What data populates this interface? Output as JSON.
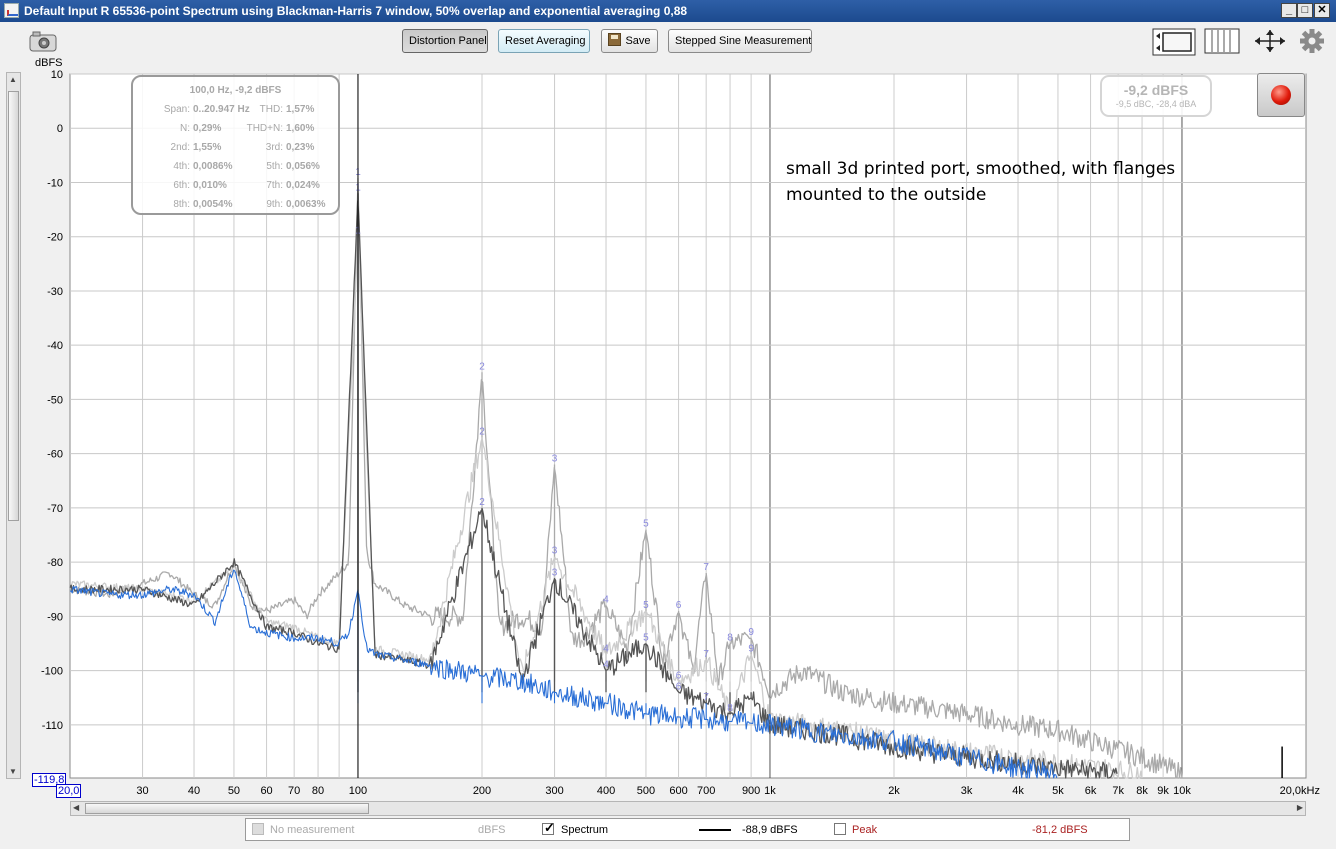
{
  "window": {
    "title": "Default Input R 65536-point Spectrum using Blackman-Harris 7 window, 50% overlap and exponential averaging 0,88",
    "minimize": "_",
    "maximize": "□",
    "close": "✕"
  },
  "toolbar": {
    "distortion_panel": "Distortion Panel",
    "reset_averaging": "Reset Averaging",
    "save": "Save",
    "stepped_sine": "Stepped Sine Measurement",
    "icons": [
      "camera-icon",
      "view-full-icon",
      "view-bars-icon",
      "zoom-arrows-icon",
      "gear-icon"
    ]
  },
  "info_box": {
    "heading": "100,0 Hz, -9,2 dBFS",
    "rows": [
      [
        {
          "k": "Span:",
          "v": "0..20.947 Hz"
        },
        {
          "k": "THD:",
          "v": "1,57%"
        }
      ],
      [
        {
          "k": "N:",
          "v": "0,29%"
        },
        {
          "k": "THD+N:",
          "v": "1,60%"
        }
      ],
      [
        {
          "k": "2nd:",
          "v": "1,55%"
        },
        {
          "k": "3rd:",
          "v": "0,23%"
        }
      ],
      [
        {
          "k": "4th:",
          "v": "0,0086%"
        },
        {
          "k": "5th:",
          "v": "0,056%"
        }
      ],
      [
        {
          "k": "6th:",
          "v": "0,010%"
        },
        {
          "k": "7th:",
          "v": "0,024%"
        }
      ],
      [
        {
          "k": "8th:",
          "v": "0,0054%"
        },
        {
          "k": "9th:",
          "v": "0,0063%"
        }
      ]
    ]
  },
  "level_box": {
    "main": "-9,2 dBFS",
    "sub": "-9,5 dBC, -28,4 dBA"
  },
  "annotation": [
    "small 3d printed port, smoothed, with flanges",
    "mounted to the outside"
  ],
  "y_min_box": "-119,8",
  "x_min_box": "20,0",
  "legend": {
    "items": [
      {
        "label": "No measurement",
        "unit": "dBFS",
        "checked": false,
        "disabled": true
      },
      {
        "label": "Spectrum",
        "value": "-88,9 dBFS",
        "checked": true
      },
      {
        "label": "Peak",
        "value": "-81,2 dBFS",
        "checked": false
      }
    ]
  },
  "colors": {
    "spectrum": "#000000",
    "blue_trace": "#2a6fd6",
    "peak": "#aa2222",
    "grid": "#c8c8c8",
    "harmonic_label": "#8888dd"
  },
  "chart_data": {
    "type": "line",
    "ylabel": "dBFS",
    "xlabel": "",
    "x_scale": "log",
    "xlim": [
      20,
      20000
    ],
    "ylim": [
      -119.8,
      10
    ],
    "grid": true,
    "y_ticks": [
      10,
      0,
      -10,
      -20,
      -30,
      -40,
      -50,
      -60,
      -70,
      -80,
      -90,
      -100,
      -110
    ],
    "x_ticks": [
      {
        "v": 30,
        "l": "30"
      },
      {
        "v": 40,
        "l": "40"
      },
      {
        "v": 50,
        "l": "50"
      },
      {
        "v": 60,
        "l": "60"
      },
      {
        "v": 70,
        "l": "70"
      },
      {
        "v": 80,
        "l": "80"
      },
      {
        "v": 100,
        "l": "100"
      },
      {
        "v": 200,
        "l": "200"
      },
      {
        "v": 300,
        "l": "300"
      },
      {
        "v": 400,
        "l": "400"
      },
      {
        "v": 500,
        "l": "500"
      },
      {
        "v": 600,
        "l": "600"
      },
      {
        "v": 700,
        "l": "700"
      },
      {
        "v": 900,
        "l": "900"
      },
      {
        "v": 1000,
        "l": "1k"
      },
      {
        "v": 2000,
        "l": "2k"
      },
      {
        "v": 3000,
        "l": "3k"
      },
      {
        "v": 4000,
        "l": "4k"
      },
      {
        "v": 5000,
        "l": "5k"
      },
      {
        "v": 6000,
        "l": "6k"
      },
      {
        "v": 7000,
        "l": "7k"
      },
      {
        "v": 8000,
        "l": "8k"
      },
      {
        "v": 9000,
        "l": "9k"
      },
      {
        "v": 10000,
        "l": "10k"
      },
      {
        "v": 20000,
        "l": "20,0kHz"
      }
    ],
    "harmonics": [
      {
        "label": "1",
        "x": 100,
        "ys": [
          -9.2,
          -12,
          -20
        ]
      },
      {
        "label": "2",
        "x": 200,
        "ys": [
          -45,
          -57,
          -70
        ]
      },
      {
        "label": "3",
        "x": 300,
        "ys": [
          -62,
          -79,
          -83
        ]
      },
      {
        "label": "4",
        "x": 400,
        "ys": [
          -88,
          -97,
          -100
        ]
      },
      {
        "label": "5",
        "x": 500,
        "ys": [
          -74,
          -89,
          -95
        ]
      },
      {
        "label": "6",
        "x": 600,
        "ys": [
          -89,
          -102,
          -104
        ]
      },
      {
        "label": "7",
        "x": 700,
        "ys": [
          -82,
          -98,
          -106
        ]
      },
      {
        "label": "8",
        "x": 800,
        "ys": [
          -95,
          -108
        ]
      },
      {
        "label": "9",
        "x": 900,
        "ys": [
          -94,
          -97
        ]
      }
    ],
    "series": [
      {
        "name": "",
        "color": "#aaaaaa",
        "points": [
          [
            20,
            -85
          ],
          [
            25,
            -86
          ],
          [
            30,
            -84
          ],
          [
            35,
            -82
          ],
          [
            40,
            -86
          ],
          [
            45,
            -88
          ],
          [
            50,
            -80
          ],
          [
            55,
            -88
          ],
          [
            60,
            -89
          ],
          [
            65,
            -88
          ],
          [
            70,
            -87
          ],
          [
            75,
            -90
          ],
          [
            80,
            -86
          ],
          [
            85,
            -84
          ],
          [
            90,
            -82
          ],
          [
            95,
            -80
          ],
          [
            100,
            -9.2
          ],
          [
            105,
            -78
          ],
          [
            110,
            -84
          ],
          [
            120,
            -86
          ],
          [
            130,
            -88
          ],
          [
            150,
            -90
          ],
          [
            180,
            -90
          ],
          [
            200,
            -45
          ],
          [
            220,
            -92
          ],
          [
            250,
            -90
          ],
          [
            280,
            -92
          ],
          [
            300,
            -62
          ],
          [
            330,
            -94
          ],
          [
            350,
            -94
          ],
          [
            400,
            -88
          ],
          [
            450,
            -96
          ],
          [
            500,
            -74
          ],
          [
            550,
            -98
          ],
          [
            600,
            -89
          ],
          [
            650,
            -100
          ],
          [
            700,
            -82
          ],
          [
            750,
            -102
          ],
          [
            800,
            -95
          ],
          [
            900,
            -94
          ],
          [
            1000,
            -104
          ],
          [
            1200,
            -100
          ],
          [
            1500,
            -104
          ],
          [
            2000,
            -106
          ],
          [
            2500,
            -107
          ],
          [
            3000,
            -108
          ],
          [
            4000,
            -110
          ],
          [
            5000,
            -111
          ],
          [
            6000,
            -113
          ],
          [
            8000,
            -116
          ],
          [
            10000,
            -119
          ]
        ]
      },
      {
        "name": "",
        "color": "#cccccc",
        "points": [
          [
            20,
            -84
          ],
          [
            30,
            -85
          ],
          [
            40,
            -87
          ],
          [
            50,
            -81
          ],
          [
            60,
            -91
          ],
          [
            70,
            -92
          ],
          [
            80,
            -94
          ],
          [
            90,
            -95
          ],
          [
            100,
            -20
          ],
          [
            110,
            -96
          ],
          [
            150,
            -98
          ],
          [
            200,
            -57
          ],
          [
            250,
            -101
          ],
          [
            300,
            -79
          ],
          [
            400,
            -97
          ],
          [
            500,
            -89
          ],
          [
            600,
            -102
          ],
          [
            700,
            -98
          ],
          [
            800,
            -108
          ],
          [
            900,
            -97
          ],
          [
            1000,
            -109
          ],
          [
            1500,
            -111
          ],
          [
            2000,
            -113
          ],
          [
            3000,
            -115
          ],
          [
            5000,
            -117
          ],
          [
            8000,
            -119
          ]
        ]
      },
      {
        "name": "",
        "color": "#555555",
        "points": [
          [
            20,
            -85
          ],
          [
            30,
            -85
          ],
          [
            40,
            -88
          ],
          [
            50,
            -80
          ],
          [
            60,
            -92
          ],
          [
            70,
            -93
          ],
          [
            80,
            -95
          ],
          [
            90,
            -96
          ],
          [
            100,
            -12
          ],
          [
            110,
            -97
          ],
          [
            150,
            -99
          ],
          [
            200,
            -70
          ],
          [
            250,
            -102
          ],
          [
            300,
            -83
          ],
          [
            400,
            -100
          ],
          [
            500,
            -95
          ],
          [
            600,
            -104
          ],
          [
            700,
            -106
          ],
          [
            800,
            -108
          ],
          [
            900,
            -105
          ],
          [
            1000,
            -110
          ],
          [
            1500,
            -112
          ],
          [
            2000,
            -114
          ],
          [
            3000,
            -116
          ],
          [
            5000,
            -118
          ],
          [
            7000,
            -119
          ]
        ]
      },
      {
        "name": "",
        "color": "#2a6fd6",
        "points": [
          [
            20,
            -85
          ],
          [
            25,
            -86
          ],
          [
            30,
            -86
          ],
          [
            35,
            -85
          ],
          [
            40,
            -86
          ],
          [
            45,
            -91
          ],
          [
            50,
            -81
          ],
          [
            55,
            -92
          ],
          [
            60,
            -93
          ],
          [
            70,
            -94
          ],
          [
            80,
            -94
          ],
          [
            90,
            -95
          ],
          [
            95,
            -93
          ],
          [
            100,
            -85
          ],
          [
            105,
            -96
          ],
          [
            110,
            -97
          ],
          [
            150,
            -99
          ],
          [
            200,
            -101
          ],
          [
            250,
            -102
          ],
          [
            300,
            -104
          ],
          [
            400,
            -106
          ],
          [
            500,
            -108
          ],
          [
            700,
            -109
          ],
          [
            1000,
            -110
          ],
          [
            1500,
            -112
          ],
          [
            2000,
            -113
          ],
          [
            3000,
            -116
          ],
          [
            4000,
            -118
          ],
          [
            5000,
            -119
          ]
        ]
      }
    ]
  }
}
